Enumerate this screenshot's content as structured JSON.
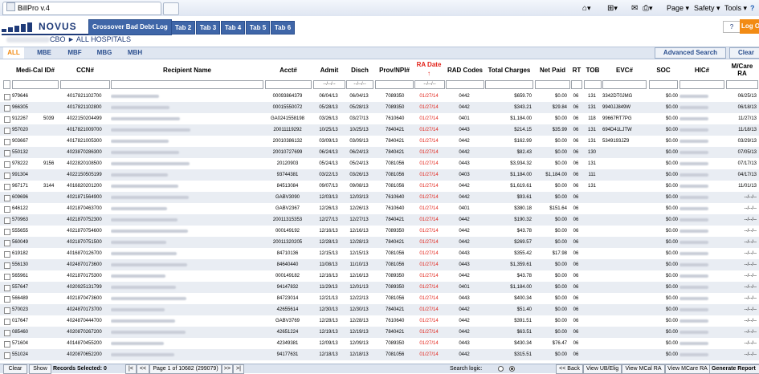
{
  "browser": {
    "tab_title": "BillPro v.4",
    "page_menu": "Page",
    "safety_menu": "Safety",
    "tools_menu": "Tools",
    "help_menu": "?"
  },
  "header": {
    "logo_text": "NOVUS",
    "hospital_path": "CBO ► ALL HOSPITALS",
    "active_tab": "Crossover Bad Debt Log",
    "tabs": [
      "Tab 2",
      "Tab 3",
      "Tab 4",
      "Tab 5",
      "Tab 6"
    ],
    "help_label": "?",
    "logout_label": "Log Out",
    "colors": {
      "brand": "#1f3b79",
      "tab": "#3f66a8",
      "accent": "#f28b14",
      "alert": "#e2231a"
    }
  },
  "subtabs": {
    "items": [
      "ALL",
      "MBE",
      "MBF",
      "MBG",
      "MBH"
    ],
    "active": "ALL",
    "advanced_search": "Advanced Search",
    "clear": "Clear"
  },
  "columns": [
    "Medi-Cal ID#",
    "CCN#",
    "Recipient Name",
    "Acct#",
    "Admit",
    "Disch",
    "Prov/NPI#",
    "RA Date",
    "RAD Codes",
    "Total Charges",
    "Net Paid",
    "RT",
    "TOB",
    "EVC#",
    "SOC",
    "HIC#",
    "M/Care RA"
  ],
  "ra_date_sort_icon": "arrow-up-icon",
  "filters": {
    "admit": "--/--/--",
    "disch": "--/--/--",
    "ra_date": "--/--/--"
  },
  "rows": [
    {
      "medical_id": "979646",
      "medical_suffix": "",
      "ccn": "4017821102700",
      "acct": "00093864379",
      "admit": "06/04/13",
      "disch": "06/04/13",
      "prov": "7089350",
      "ra_date": "01/27/14",
      "rad": "0442",
      "total": "$659.70",
      "net": "$0.00",
      "rt": "06",
      "tob": "131",
      "evc": "3342DT0JMG",
      "soc": "$0.00",
      "mcare_ra": "06/25/13"
    },
    {
      "medical_id": "966305",
      "medical_suffix": "",
      "ccn": "4017821102800",
      "acct": "00015550072",
      "admit": "05/28/13",
      "disch": "05/28/13",
      "prov": "7089350",
      "ra_date": "01/27/14",
      "rad": "0442",
      "total": "$343.21",
      "net": "$29.84",
      "rt": "06",
      "tob": "131",
      "evc": "9940JJ849W",
      "soc": "$0.00",
      "mcare_ra": "06/18/13"
    },
    {
      "medical_id": "912267",
      "medical_suffix": "5039",
      "ccn": "4022150204499",
      "acct": "GA0241558198",
      "admit": "03/26/13",
      "disch": "03/27/13",
      "prov": "7610640",
      "ra_date": "01/27/14",
      "rad": "0401",
      "total": "$1,184.00",
      "net": "$0.00",
      "rt": "06",
      "tob": "118",
      "evc": "99667RT7PG",
      "soc": "$0.00",
      "mcare_ra": "11/27/13"
    },
    {
      "medical_id": "957020",
      "medical_suffix": "",
      "ccn": "4017821009700",
      "acct": "20011119292",
      "admit": "10/25/13",
      "disch": "10/25/13",
      "prov": "7840421",
      "ra_date": "01/27/14",
      "rad": "0443",
      "total": "$214.15",
      "net": "$35.99",
      "rt": "06",
      "tob": "131",
      "evc": "694D41LJTW",
      "soc": "$0.00",
      "mcare_ra": "11/18/13"
    },
    {
      "medical_id": "903667",
      "medical_suffix": "",
      "ccn": "4017821005300",
      "acct": "20010386132",
      "admit": "03/09/13",
      "disch": "03/09/13",
      "prov": "7840421",
      "ra_date": "01/27/14",
      "rad": "0442",
      "total": "$162.99",
      "net": "$0.00",
      "rt": "06",
      "tob": "131",
      "evc": "5349193JZ9",
      "soc": "$0.00",
      "mcare_ra": "03/29/13"
    },
    {
      "medical_id": "550132",
      "medical_suffix": "",
      "ccn": "4023870286300",
      "acct": "20010727699",
      "admit": "06/24/13",
      "disch": "06/24/13",
      "prov": "7840421",
      "ra_date": "01/27/14",
      "rad": "0442",
      "total": "$82.43",
      "net": "$0.00",
      "rt": "06",
      "tob": "130",
      "evc": "",
      "soc": "$0.00",
      "mcare_ra": "07/05/13"
    },
    {
      "medical_id": "978222",
      "medical_suffix": "9156",
      "ccn": "4022820108500",
      "acct": "20120903",
      "admit": "05/24/13",
      "disch": "05/24/13",
      "prov": "7081056",
      "ra_date": "01/27/14",
      "rad": "0443",
      "total": "$3,934.32",
      "net": "$0.00",
      "rt": "06",
      "tob": "131",
      "evc": "",
      "soc": "$0.00",
      "mcare_ra": "07/17/13"
    },
    {
      "medical_id": "991304",
      "medical_suffix": "",
      "ccn": "4022150505199",
      "acct": "93744381",
      "admit": "03/22/13",
      "disch": "03/26/13",
      "prov": "7081056",
      "ra_date": "01/27/14",
      "rad": "0403",
      "total": "$1,184.00",
      "net": "$1,184.00",
      "rt": "06",
      "tob": "111",
      "evc": "",
      "soc": "$0.00",
      "mcare_ra": "04/17/13"
    },
    {
      "medical_id": "967171",
      "medical_suffix": "3144",
      "ccn": "4016820201200",
      "acct": "84513084",
      "admit": "09/07/13",
      "disch": "09/08/13",
      "prov": "7081056",
      "ra_date": "01/27/14",
      "rad": "0442",
      "total": "$1,619.61",
      "net": "$0.00",
      "rt": "06",
      "tob": "131",
      "evc": "",
      "soc": "$0.00",
      "mcare_ra": "11/01/13"
    },
    {
      "medical_id": "609696",
      "medical_suffix": "",
      "ccn": "4021871564900",
      "acct": "GABV3090",
      "admit": "12/03/13",
      "disch": "12/03/13",
      "prov": "7610640",
      "ra_date": "01/27/14",
      "rad": "0442",
      "total": "$93.61",
      "net": "$0.00",
      "rt": "06",
      "tob": "",
      "evc": "",
      "soc": "$0.00",
      "mcare_ra": "--/--/--"
    },
    {
      "medical_id": "646122",
      "medical_suffix": "",
      "ccn": "4021870463700",
      "acct": "GABV2367",
      "admit": "12/26/13",
      "disch": "12/26/13",
      "prov": "7610640",
      "ra_date": "01/27/14",
      "rad": "0401",
      "total": "$380.18",
      "net": "$151.64",
      "rt": "06",
      "tob": "",
      "evc": "",
      "soc": "$0.00",
      "mcare_ra": "--/--/--"
    },
    {
      "medical_id": "570963",
      "medical_suffix": "",
      "ccn": "4021870752300",
      "acct": "20011315353",
      "admit": "12/27/13",
      "disch": "12/27/13",
      "prov": "7840421",
      "ra_date": "01/27/14",
      "rad": "0442",
      "total": "$190.32",
      "net": "$0.00",
      "rt": "06",
      "tob": "",
      "evc": "",
      "soc": "$0.00",
      "mcare_ra": "--/--/--"
    },
    {
      "medical_id": "555655",
      "medical_suffix": "",
      "ccn": "4021870754600",
      "acct": "000149192",
      "admit": "12/16/13",
      "disch": "12/16/13",
      "prov": "7089350",
      "ra_date": "01/27/14",
      "rad": "0442",
      "total": "$43.78",
      "net": "$0.00",
      "rt": "06",
      "tob": "",
      "evc": "",
      "soc": "$0.00",
      "mcare_ra": "--/--/--"
    },
    {
      "medical_id": "560049",
      "medical_suffix": "",
      "ccn": "4021870751500",
      "acct": "20011320205",
      "admit": "12/28/13",
      "disch": "12/28/13",
      "prov": "7840421",
      "ra_date": "01/27/14",
      "rad": "0442",
      "total": "$269.57",
      "net": "$0.00",
      "rt": "06",
      "tob": "",
      "evc": "",
      "soc": "$0.00",
      "mcare_ra": "--/--/--"
    },
    {
      "medical_id": "619182",
      "medical_suffix": "",
      "ccn": "4016870126700",
      "acct": "84710136",
      "admit": "12/15/13",
      "disch": "12/15/13",
      "prov": "7081056",
      "ra_date": "01/27/14",
      "rad": "0443",
      "total": "$355.42",
      "net": "$17.98",
      "rt": "06",
      "tob": "",
      "evc": "",
      "soc": "$0.00",
      "mcare_ra": "--/--/--"
    },
    {
      "medical_id": "556130",
      "medical_suffix": "",
      "ccn": "4024870173600",
      "acct": "84640440",
      "admit": "11/08/13",
      "disch": "11/10/13",
      "prov": "7081056",
      "ra_date": "01/27/14",
      "rad": "0443",
      "total": "$1,359.61",
      "net": "$0.00",
      "rt": "06",
      "tob": "",
      "evc": "",
      "soc": "$0.00",
      "mcare_ra": "--/--/--"
    },
    {
      "medical_id": "565961",
      "medical_suffix": "",
      "ccn": "4021870175300",
      "acct": "000149182",
      "admit": "12/16/13",
      "disch": "12/16/13",
      "prov": "7089350",
      "ra_date": "01/27/14",
      "rad": "0442",
      "total": "$43.78",
      "net": "$0.00",
      "rt": "06",
      "tob": "",
      "evc": "",
      "soc": "$0.00",
      "mcare_ra": "--/--/--"
    },
    {
      "medical_id": "557647",
      "medical_suffix": "",
      "ccn": "4020925131799",
      "acct": "94147832",
      "admit": "11/29/13",
      "disch": "12/01/13",
      "prov": "7089350",
      "ra_date": "01/27/14",
      "rad": "0401",
      "total": "$1,184.00",
      "net": "$0.00",
      "rt": "06",
      "tob": "",
      "evc": "",
      "soc": "$0.00",
      "mcare_ra": "--/--/--"
    },
    {
      "medical_id": "566489",
      "medical_suffix": "",
      "ccn": "4021870473600",
      "acct": "84723014",
      "admit": "12/21/13",
      "disch": "12/22/13",
      "prov": "7081056",
      "ra_date": "01/27/14",
      "rad": "0443",
      "total": "$400.34",
      "net": "$0.00",
      "rt": "06",
      "tob": "",
      "evc": "",
      "soc": "$0.00",
      "mcare_ra": "--/--/--"
    },
    {
      "medical_id": "570023",
      "medical_suffix": "",
      "ccn": "4024870173700",
      "acct": "42655614",
      "admit": "12/30/13",
      "disch": "12/30/13",
      "prov": "7840421",
      "ra_date": "01/27/14",
      "rad": "0442",
      "total": "$51.40",
      "net": "$0.00",
      "rt": "06",
      "tob": "",
      "evc": "",
      "soc": "$0.00",
      "mcare_ra": "--/--/--"
    },
    {
      "medical_id": "017647",
      "medical_suffix": "",
      "ccn": "4024870444700",
      "acct": "GABV3769",
      "admit": "12/28/13",
      "disch": "12/28/13",
      "prov": "7610640",
      "ra_date": "01/27/14",
      "rad": "0442",
      "total": "$391.51",
      "net": "$0.00",
      "rt": "06",
      "tob": "",
      "evc": "",
      "soc": "$0.00",
      "mcare_ra": "--/--/--"
    },
    {
      "medical_id": "085460",
      "medical_suffix": "",
      "ccn": "4020870267200",
      "acct": "42651224",
      "admit": "12/19/13",
      "disch": "12/19/13",
      "prov": "7840421",
      "ra_date": "01/27/14",
      "rad": "0442",
      "total": "$63.51",
      "net": "$0.00",
      "rt": "06",
      "tob": "",
      "evc": "",
      "soc": "$0.00",
      "mcare_ra": "--/--/--"
    },
    {
      "medical_id": "571604",
      "medical_suffix": "",
      "ccn": "4014870455200",
      "acct": "42349381",
      "admit": "12/09/13",
      "disch": "12/09/13",
      "prov": "7089350",
      "ra_date": "01/27/14",
      "rad": "0443",
      "total": "$430.34",
      "net": "$76.47",
      "rt": "06",
      "tob": "",
      "evc": "",
      "soc": "$0.00",
      "mcare_ra": "--/--/--"
    },
    {
      "medical_id": "551024",
      "medical_suffix": "",
      "ccn": "4020870652200",
      "acct": "94177631",
      "admit": "12/18/13",
      "disch": "12/18/13",
      "prov": "7081056",
      "ra_date": "01/27/14",
      "rad": "0442",
      "total": "$315.51",
      "net": "$0.00",
      "rt": "06",
      "tob": "",
      "evc": "",
      "soc": "$0.00",
      "mcare_ra": "--/--/--"
    }
  ],
  "footer": {
    "clear_label": "Clear",
    "show_label": "Show",
    "records_selected": "Records Selected: 0",
    "first_label": "|<",
    "prev_label": "<<",
    "page_info": "Page 1 of 10682 (299079)",
    "next_label": ">>",
    "last_label": ">|",
    "search_logic_label": "Search logic:",
    "back_label": "<< Back",
    "view_ub": "View UB/Elig",
    "view_mcal": "View MCal RA",
    "view_mcare": "View MCare RA",
    "generate_report": "Generate Report"
  }
}
